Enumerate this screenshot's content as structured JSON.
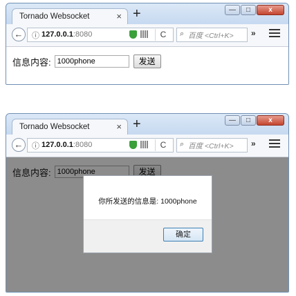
{
  "tab_title": "Tornado Websocket",
  "tab_close": "×",
  "new_tab": "+",
  "window_buttons": {
    "minimize": "—",
    "maximize": "□",
    "close": "x"
  },
  "address": {
    "host": "127.0.0.1",
    "port": ":8080",
    "info_glyph": "ⓘ",
    "reload_glyph": "C"
  },
  "search": {
    "placeholder": "百度 <Ctrl+K>",
    "icon_glyph": "⌕"
  },
  "toolbar": {
    "overflow": "»",
    "back_glyph": "←"
  },
  "form": {
    "label": "信息内容:",
    "input_value": "1000phone",
    "send_label": "发送"
  },
  "dialog": {
    "message": "你所发送的信息是: 1000phone",
    "ok_label": "确定"
  },
  "colors": {
    "title_frame": "#c9dcf2",
    "overlay": "#7a7a7a",
    "close_button": "#c4462f",
    "shield": "#3aa03a"
  }
}
